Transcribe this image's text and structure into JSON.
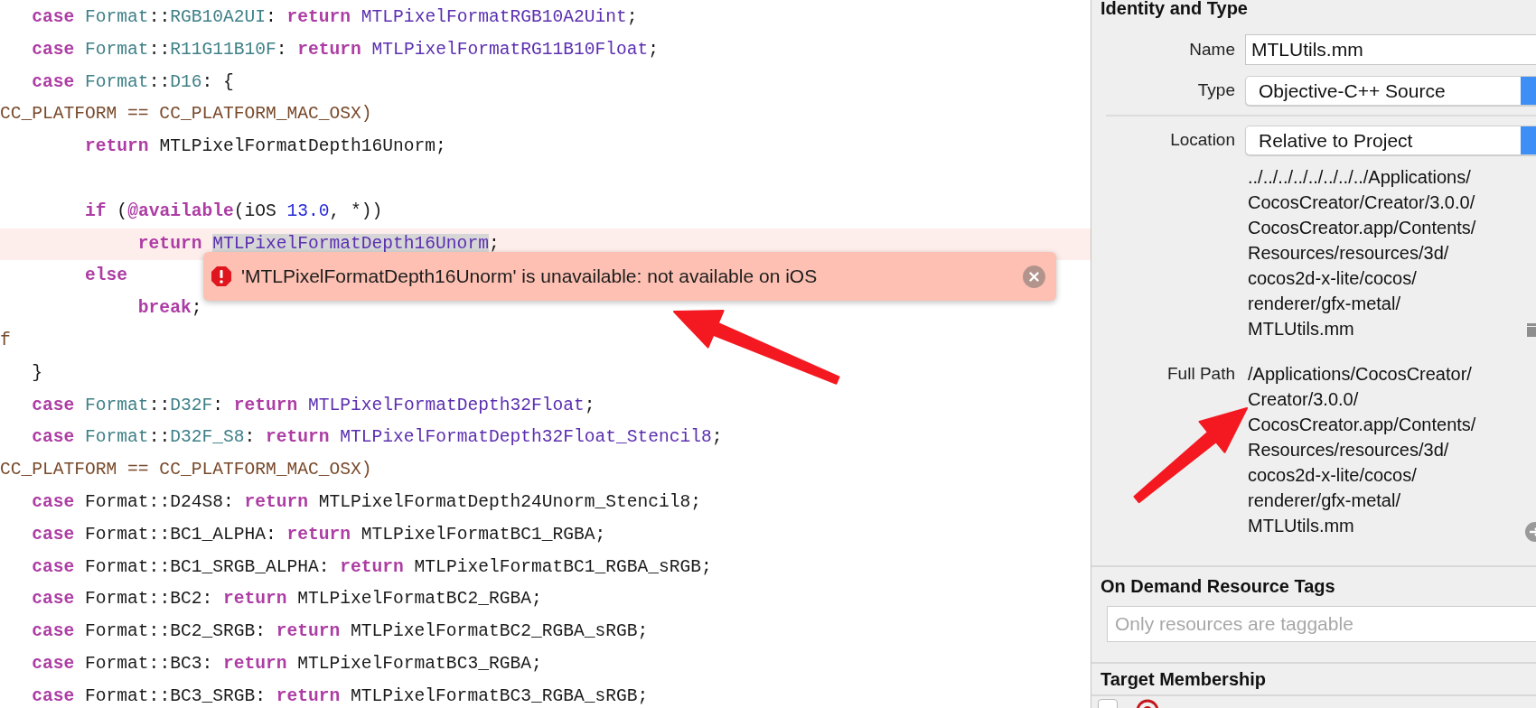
{
  "editor": {
    "lines": [
      {
        "tokens": [
          {
            "kind": "keyword",
            "text": "   case"
          },
          {
            "kind": "type",
            "text": " Format"
          },
          {
            "kind": "plain",
            "text": "::"
          },
          {
            "kind": "type",
            "text": "RGB10A2UI"
          },
          {
            "kind": "plain",
            "text": ": "
          },
          {
            "kind": "keyword",
            "text": "return"
          },
          {
            "kind": "constant",
            "text": " MTLPixelFormatRGB10A2Uint"
          },
          {
            "kind": "plain",
            "text": ";"
          }
        ]
      },
      {
        "tokens": [
          {
            "kind": "keyword",
            "text": "   case"
          },
          {
            "kind": "type",
            "text": " Format"
          },
          {
            "kind": "plain",
            "text": "::"
          },
          {
            "kind": "type",
            "text": "R11G11B10F"
          },
          {
            "kind": "plain",
            "text": ": "
          },
          {
            "kind": "keyword",
            "text": "return"
          },
          {
            "kind": "constant",
            "text": " MTLPixelFormatRG11B10Float"
          },
          {
            "kind": "plain",
            "text": ";"
          }
        ]
      },
      {
        "tokens": [
          {
            "kind": "keyword",
            "text": "   case"
          },
          {
            "kind": "type",
            "text": " Format"
          },
          {
            "kind": "plain",
            "text": "::"
          },
          {
            "kind": "type",
            "text": "D16"
          },
          {
            "kind": "plain",
            "text": ": {"
          }
        ]
      },
      {
        "tokens": [
          {
            "kind": "preproc",
            "text": "CC_PLATFORM == CC_PLATFORM_MAC_OSX)"
          }
        ]
      },
      {
        "tokens": [
          {
            "kind": "keyword",
            "text": "        return"
          },
          {
            "kind": "plain",
            "text": " MTLPixelFormatDepth16Unorm;"
          }
        ]
      },
      {
        "kind": "blank"
      },
      {
        "tokens": [
          {
            "kind": "keyword",
            "text": "        if"
          },
          {
            "kind": "plain",
            "text": " ("
          },
          {
            "kind": "keyword",
            "text": "@available"
          },
          {
            "kind": "plain",
            "text": "(iOS "
          },
          {
            "kind": "number",
            "text": "13.0"
          },
          {
            "kind": "plain",
            "text": ", *))"
          }
        ]
      },
      {
        "error": true,
        "tokens": [
          {
            "kind": "keyword",
            "text": "             return "
          },
          {
            "kind": "constant",
            "text": "M",
            "selected": true,
            "underlined": true
          },
          {
            "kind": "constant",
            "text": "TLPixelFormatDepth16Unorm",
            "selected": true
          },
          {
            "kind": "plain",
            "text": ";"
          }
        ]
      },
      {
        "tokens": [
          {
            "kind": "keyword",
            "text": "        else"
          }
        ]
      },
      {
        "tokens": [
          {
            "kind": "keyword",
            "text": "             break"
          },
          {
            "kind": "plain",
            "text": ";"
          }
        ]
      },
      {
        "tokens": [
          {
            "kind": "preproc",
            "text": "f"
          }
        ]
      },
      {
        "tokens": [
          {
            "kind": "plain",
            "text": "   }"
          }
        ]
      },
      {
        "tokens": [
          {
            "kind": "keyword",
            "text": "   case"
          },
          {
            "kind": "type",
            "text": " Format"
          },
          {
            "kind": "plain",
            "text": "::"
          },
          {
            "kind": "type",
            "text": "D32F"
          },
          {
            "kind": "plain",
            "text": ": "
          },
          {
            "kind": "keyword",
            "text": "return"
          },
          {
            "kind": "constant",
            "text": " MTLPixelFormatDepth32Float"
          },
          {
            "kind": "plain",
            "text": ";"
          }
        ]
      },
      {
        "tokens": [
          {
            "kind": "keyword",
            "text": "   case"
          },
          {
            "kind": "type",
            "text": " Format"
          },
          {
            "kind": "plain",
            "text": "::"
          },
          {
            "kind": "type",
            "text": "D32F_S8"
          },
          {
            "kind": "plain",
            "text": ": "
          },
          {
            "kind": "keyword",
            "text": "return"
          },
          {
            "kind": "constant",
            "text": " MTLPixelFormatDepth32Float_Stencil8"
          },
          {
            "kind": "plain",
            "text": ";"
          }
        ]
      },
      {
        "tokens": [
          {
            "kind": "preproc",
            "text": "CC_PLATFORM == CC_PLATFORM_MAC_OSX)"
          }
        ]
      },
      {
        "tokens": [
          {
            "kind": "keyword",
            "text": "   case"
          },
          {
            "kind": "plain",
            "text": " Format::D24S8: "
          },
          {
            "kind": "keyword",
            "text": "return"
          },
          {
            "kind": "plain",
            "text": " MTLPixelFormatDepth24Unorm_Stencil8;"
          }
        ]
      },
      {
        "tokens": [
          {
            "kind": "keyword",
            "text": "   case"
          },
          {
            "kind": "plain",
            "text": " Format::BC1_ALPHA: "
          },
          {
            "kind": "keyword",
            "text": "return"
          },
          {
            "kind": "plain",
            "text": " MTLPixelFormatBC1_RGBA;"
          }
        ]
      },
      {
        "tokens": [
          {
            "kind": "keyword",
            "text": "   case"
          },
          {
            "kind": "plain",
            "text": " Format::BC1_SRGB_ALPHA: "
          },
          {
            "kind": "keyword",
            "text": "return"
          },
          {
            "kind": "plain",
            "text": " MTLPixelFormatBC1_RGBA_sRGB;"
          }
        ]
      },
      {
        "tokens": [
          {
            "kind": "keyword",
            "text": "   case"
          },
          {
            "kind": "plain",
            "text": " Format::BC2: "
          },
          {
            "kind": "keyword",
            "text": "return"
          },
          {
            "kind": "plain",
            "text": " MTLPixelFormatBC2_RGBA;"
          }
        ]
      },
      {
        "tokens": [
          {
            "kind": "keyword",
            "text": "   case"
          },
          {
            "kind": "plain",
            "text": " Format::BC2_SRGB: "
          },
          {
            "kind": "keyword",
            "text": "return"
          },
          {
            "kind": "plain",
            "text": " MTLPixelFormatBC2_RGBA_sRGB;"
          }
        ]
      },
      {
        "tokens": [
          {
            "kind": "keyword",
            "text": "   case"
          },
          {
            "kind": "plain",
            "text": " Format::BC3: "
          },
          {
            "kind": "keyword",
            "text": "return"
          },
          {
            "kind": "plain",
            "text": " MTLPixelFormatBC3_RGBA;"
          }
        ]
      },
      {
        "tokens": [
          {
            "kind": "keyword",
            "text": "   case"
          },
          {
            "kind": "plain",
            "text": " Format::BC3_SRGB: "
          },
          {
            "kind": "keyword",
            "text": "return"
          },
          {
            "kind": "plain",
            "text": " MTLPixelFormatBC3_RGBA_sRGB;"
          }
        ]
      }
    ],
    "error_popup": {
      "message": "'MTLPixelFormatDepth16Unorm' is unavailable: not available on iOS"
    }
  },
  "inspector": {
    "identity": {
      "title": "Identity and Type",
      "name_label": "Name",
      "name_value": "MTLUtils.mm",
      "type_label": "Type",
      "type_value": "Objective-C++ Source",
      "location_label": "Location",
      "location_value": "Relative to Project",
      "location_path": [
        "../../../../../../../../Applications/",
        "CocosCreator/Creator/3.0.0/",
        "CocosCreator.app/Contents/",
        "Resources/resources/3d/",
        "cocos2d-x-lite/cocos/",
        "renderer/gfx-metal/",
        "MTLUtils.mm"
      ],
      "full_path_label": "Full Path",
      "full_path": [
        "/Applications/CocosCreator/",
        "Creator/3.0.0/",
        "CocosCreator.app/Contents/",
        "Resources/resources/3d/",
        "cocos2d-x-lite/cocos/",
        "renderer/gfx-metal/",
        "MTLUtils.mm"
      ]
    },
    "on_demand": {
      "title": "On Demand Resource Tags",
      "placeholder": "Only resources are taggable"
    },
    "target_membership": {
      "title": "Target Membership",
      "targets": [
        {
          "checked": false
        }
      ]
    }
  },
  "annotations": [
    {
      "kind": "arrow"
    },
    {
      "kind": "arrow"
    }
  ]
}
